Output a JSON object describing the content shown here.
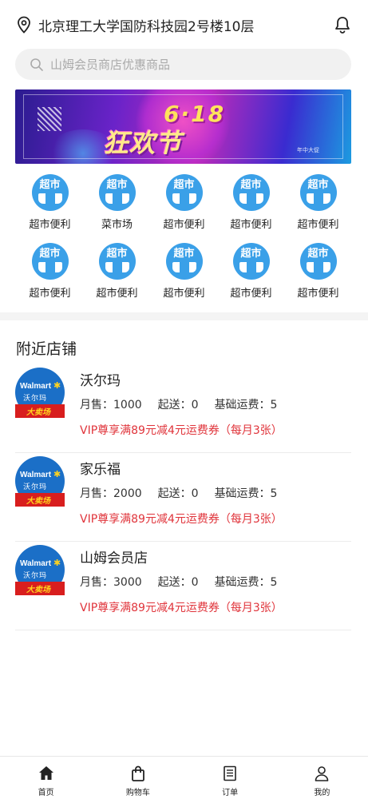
{
  "header": {
    "location": "北京理工大学国防科技园2号楼10层",
    "location_icon": "location-pin-icon",
    "bell_icon": "bell-icon"
  },
  "search": {
    "placeholder": "山姆会员商店优惠商品",
    "icon": "search-icon"
  },
  "banner": {
    "line1": "6·18",
    "line2": "狂欢节",
    "tagline": "年中大促"
  },
  "categories": [
    {
      "icon_text": "超市",
      "label": "超市便利"
    },
    {
      "icon_text": "超市",
      "label": "菜市场"
    },
    {
      "icon_text": "超市",
      "label": "超市便利"
    },
    {
      "icon_text": "超市",
      "label": "超市便利"
    },
    {
      "icon_text": "超市",
      "label": "超市便利"
    },
    {
      "icon_text": "超市",
      "label": "超市便利"
    },
    {
      "icon_text": "超市",
      "label": "超市便利"
    },
    {
      "icon_text": "超市",
      "label": "超市便利"
    },
    {
      "icon_text": "超市",
      "label": "超市便利"
    },
    {
      "icon_text": "超市",
      "label": "超市便利"
    }
  ],
  "nearby": {
    "title": "附近店铺",
    "stores": [
      {
        "name": "沃尔玛",
        "logo_brand": "Walmart",
        "logo_cn": "沃尔玛",
        "logo_tag": "大卖场",
        "monthly_sales": "月售：1000",
        "min_delivery": "起送：0",
        "base_fee": "基础运费：5",
        "vip": "VIP尊享满89元减4元运费券（每月3张）"
      },
      {
        "name": "家乐福",
        "logo_brand": "Walmart",
        "logo_cn": "沃尔玛",
        "logo_tag": "大卖场",
        "monthly_sales": "月售：2000",
        "min_delivery": "起送：0",
        "base_fee": "基础运费：5",
        "vip": "VIP尊享满89元减4元运费券（每月3张）"
      },
      {
        "name": "山姆会员店",
        "logo_brand": "Walmart",
        "logo_cn": "沃尔玛",
        "logo_tag": "大卖场",
        "monthly_sales": "月售：3000",
        "min_delivery": "起送：0",
        "base_fee": "基础运费：5",
        "vip": "VIP尊享满89元减4元运费券（每月3张）"
      }
    ]
  },
  "tabbar": [
    {
      "label": "首页",
      "icon": "home-icon"
    },
    {
      "label": "购物车",
      "icon": "shopping-bag-icon"
    },
    {
      "label": "订单",
      "icon": "order-list-icon"
    },
    {
      "label": "我的",
      "icon": "user-icon"
    }
  ],
  "colors": {
    "accent": "#3aa0e8",
    "vip_red": "#e0343b",
    "walmart_blue": "#1b6fc7"
  }
}
